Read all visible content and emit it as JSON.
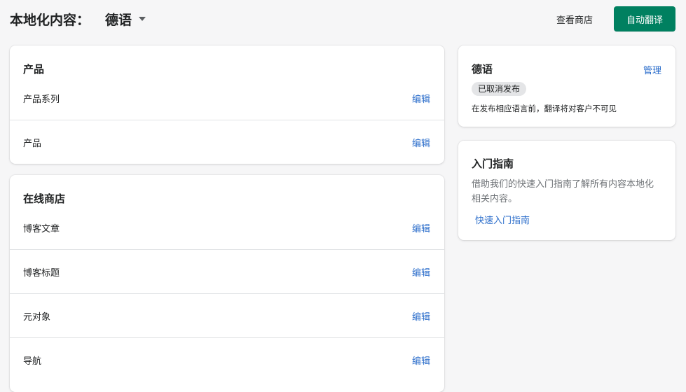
{
  "header": {
    "title": "本地化内容：",
    "language_value": "德语",
    "view_store_label": "查看商店",
    "auto_translate_label": "自动翻译"
  },
  "products_card": {
    "title": "产品",
    "edit_label": "编辑",
    "rows": [
      {
        "label": "产品系列"
      },
      {
        "label": "产品"
      }
    ]
  },
  "online_store_card": {
    "title": "在线商店",
    "edit_label": "编辑",
    "rows": [
      {
        "label": "博客文章"
      },
      {
        "label": "博客标题"
      },
      {
        "label": "元对象"
      },
      {
        "label": "导航"
      }
    ]
  },
  "language_card": {
    "title": "德语",
    "manage_label": "管理",
    "status_badge": "已取消发布",
    "note": "在发布相应语言前，翻译将对客户不可见"
  },
  "guide_card": {
    "title": "入门指南",
    "description": "借助我们的快速入门指南了解所有内容本地化相关内容。",
    "link_label": "快速入门指南"
  },
  "colors": {
    "primary": "#008060",
    "link": "#2c6ecb",
    "background": "#f6f6f7"
  }
}
